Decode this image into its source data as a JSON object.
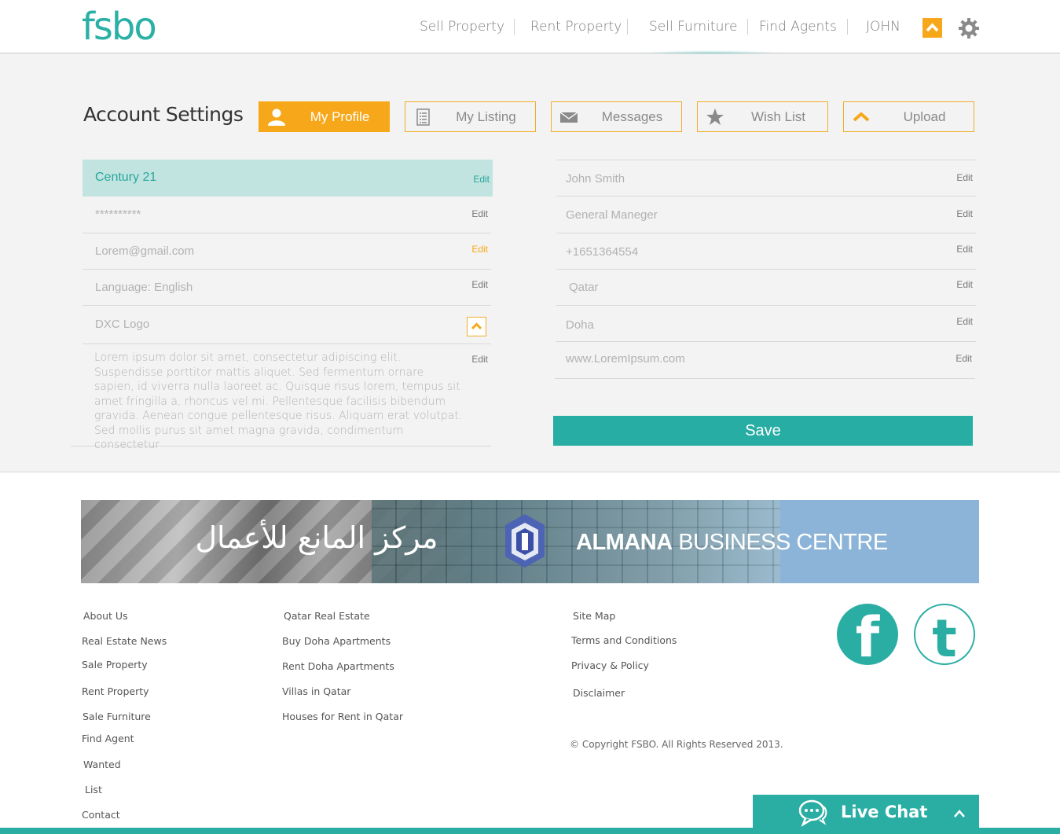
{
  "brand": {
    "logo": "fsbo"
  },
  "nav": {
    "items": [
      "Sell Property",
      "Rent Property",
      "Sell Furniture",
      "Find Agents"
    ],
    "user": "JOHN"
  },
  "page": {
    "title": "Account Settings"
  },
  "tabs": [
    {
      "label": "My Profile",
      "icon": "user-icon",
      "active": true
    },
    {
      "label": "My Listing",
      "icon": "document-list-icon",
      "active": false
    },
    {
      "label": "Messages",
      "icon": "envelope-icon",
      "active": false
    },
    {
      "label": "Wish List",
      "icon": "star-icon",
      "active": false
    },
    {
      "label": "Upload",
      "icon": "chevron-up-icon",
      "active": false
    }
  ],
  "left_fields": [
    {
      "value": "Century 21",
      "action": "Edit"
    },
    {
      "value": "**********",
      "action": "Edit"
    },
    {
      "value": "Lorem@gmail.com",
      "action": "Edit"
    },
    {
      "value": "Language: English",
      "action": "Edit"
    },
    {
      "value": "DXC Logo",
      "action": "upload-icon"
    }
  ],
  "description": {
    "text": "Lorem ipsum dolor sit amet, consectetur adipiscing elit. Suspendisse porttitor mattis aliquet. Sed fermentum ornare sapien, id viverra nulla laoreet ac. Quisque risus lorem, tempus sit amet fringilla a, rhoncus vel mi. Pellentesque facilisis bibendum gravida. Aenean congue pellentesque risus. Aliquam erat volutpat. Sed mollis purus sit amet magna gravida, condimentum consectetur",
    "action": "Edit"
  },
  "right_fields": [
    {
      "value": "John Smith",
      "action": "Edit"
    },
    {
      "value": "General Maneger",
      "action": "Edit"
    },
    {
      "value": "+1651364554",
      "action": "Edit"
    },
    {
      "value": "Qatar",
      "action": "Edit"
    },
    {
      "value": "Doha",
      "action": "Edit"
    },
    {
      "value": "www.LoremIpsum.com",
      "action": "Edit"
    }
  ],
  "save_label": "Save",
  "banner": {
    "arabic": "مركز المانع للأعمال",
    "name_bold": "ALMANA",
    "name_rest": " BUSINESS CENTRE"
  },
  "footer": {
    "col1": [
      "About Us",
      "Real Estate News",
      "Sale Property",
      "Rent Property",
      "Sale Furniture",
      "Find Agent",
      "Wanted",
      "List",
      "Contact"
    ],
    "col2": [
      "Qatar Real Estate",
      "Buy Doha Apartments",
      "Rent Doha Apartments",
      "Villas in Qatar",
      "Houses for Rent in Qatar"
    ],
    "col3": [
      "Site Map",
      "Terms and Conditions",
      "Privacy & Policy",
      "Disclaimer"
    ],
    "copyright": "© Copyright FSBO. All Rights Reserved 2013."
  },
  "social": {
    "facebook": "f",
    "twitter": "t"
  },
  "live_chat": {
    "label": "Live Chat"
  },
  "colors": {
    "accent": "#2aaea4",
    "highlight": "#f7a81a",
    "row_highlight": "#c2e4e1"
  }
}
